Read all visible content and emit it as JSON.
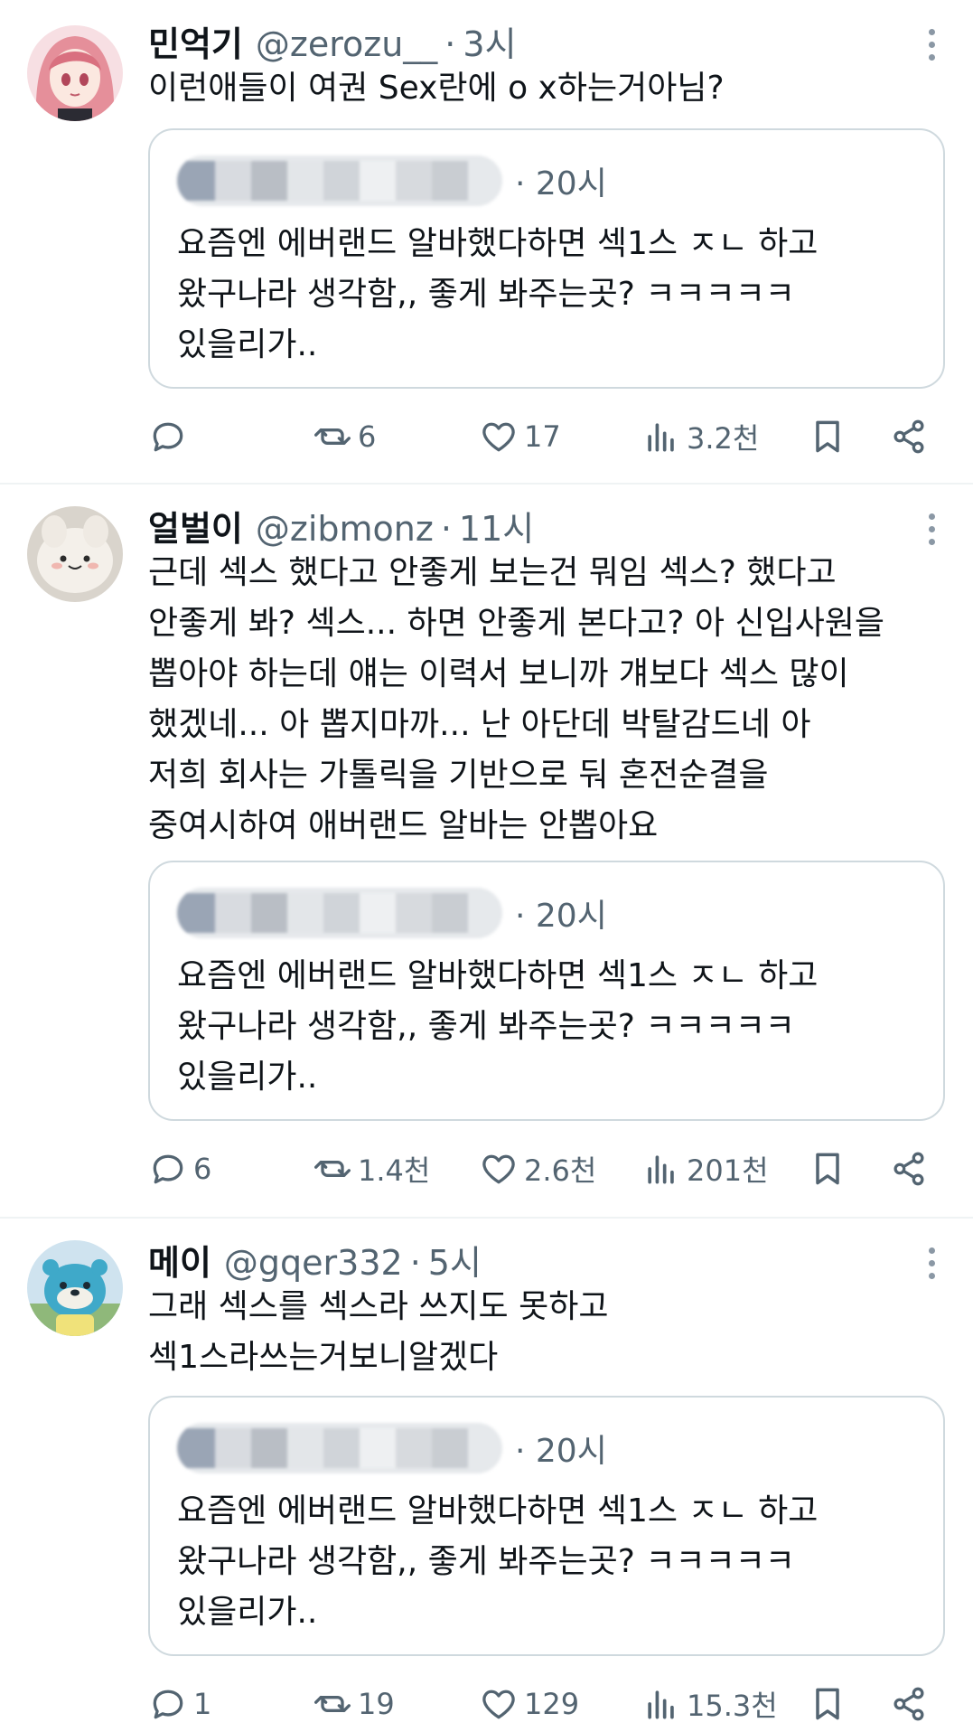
{
  "quoted": {
    "time": "20시",
    "text": "요즘엔 에버랜드 알바했다하면 섹1스 ㅈㄴ 하고\n왔구나라 생각함,, 좋게 봐주는곳? ㅋㅋㅋㅋㅋ\n있을리가.."
  },
  "tweets": [
    {
      "name": "민억기",
      "handle": "@zerozu__",
      "time": "3시",
      "text": "이런애들이 여권 Sex란에 o x하는거아님?",
      "replies": "",
      "retweets": "6",
      "likes": "17",
      "views": "3.2천"
    },
    {
      "name": "얼벌이",
      "handle": "@zibmonz",
      "time": "11시",
      "text": "근데 섹스 했다고 안좋게 보는건 뭐임 섹스? 했다고\n안좋게 봐? 섹스... 하면 안좋게 본다고? 아 신입사원을\n뽑아야 하는데 얘는 이력서 보니까 걔보다 섹스 많이\n했겠네... 아 뽑지마까... 난 아단데 박탈감드네 아\n저희 회사는 가톨릭을 기반으로 둬 혼전순결을\n중여시하여 애버랜드 알바는 안뽑아요",
      "replies": "6",
      "retweets": "1.4천",
      "likes": "2.6천",
      "views": "201천"
    },
    {
      "name": "메이",
      "handle": "@gqer332",
      "time": "5시",
      "text": "그래 섹스를 섹스라 쓰지도 못하고\n섹1스라쓰는거보니알겠다",
      "replies": "1",
      "retweets": "19",
      "likes": "129",
      "views": "15.3천"
    }
  ],
  "icons": [
    "reply-icon",
    "retweet-icon",
    "like-icon",
    "views-icon",
    "bookmark-icon",
    "share-icon",
    "more-icon"
  ],
  "colors": {
    "text": "#0f1419",
    "secondary": "#536471",
    "border": "#cfd9de",
    "divider": "#eff3f4"
  }
}
